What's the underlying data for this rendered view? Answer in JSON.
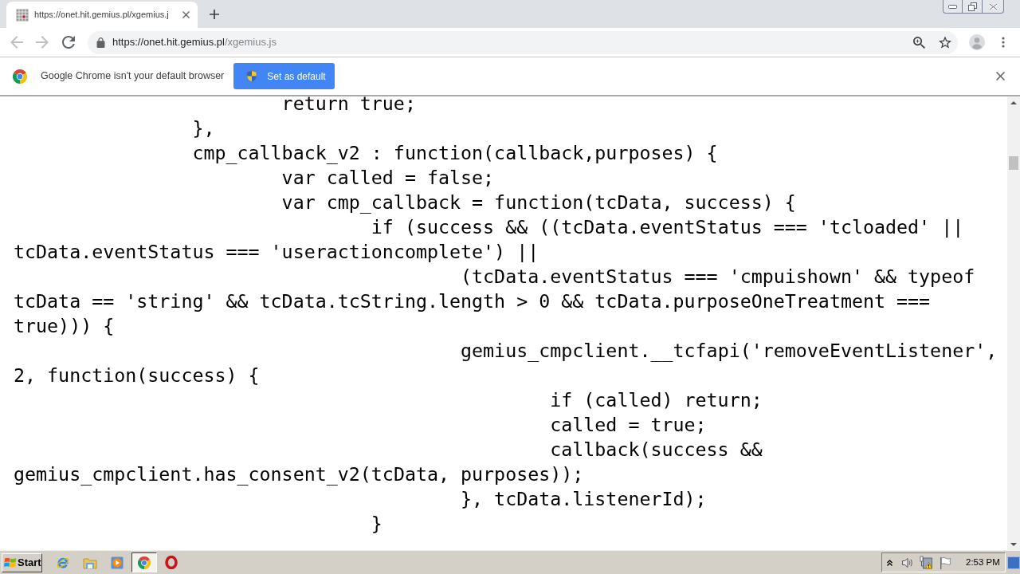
{
  "browser": {
    "tabs": [
      {
        "title": "https://onet.hit.gemius.pl/xgemius.j",
        "selected": true
      }
    ],
    "address_bar": {
      "host": "https://onet.hit.gemius.pl",
      "path": "/xgemius.js"
    }
  },
  "infobar": {
    "message": "Google Chrome isn't your default browser",
    "button": "Set as default"
  },
  "code_lines": [
    "\t\t\treturn true;",
    "\t\t},",
    "\t\tcmp_callback_v2 : function(callback,purposes) {",
    "\t\t\tvar called = false;",
    "\t\t\tvar cmp_callback = function(tcData, success) {",
    "\t\t\t\tif (success && ((tcData.eventStatus === 'tcloaded' ||",
    "tcData.eventStatus === 'useractioncomplete') ||",
    "\t\t\t\t\t(tcData.eventStatus === 'cmpuishown' && typeof",
    "tcData == 'string' && tcData.tcString.length > 0 && tcData.purposeOneTreatment ===",
    "true))) {",
    "\t\t\t\t\tgemius_cmpclient.__tcfapi('removeEventListener',",
    "2, function(success) {",
    "\t\t\t\t\t\tif (called) return;",
    "\t\t\t\t\t\tcalled = true;",
    "\t\t\t\t\t\tcallback(success &&",
    "gemius_cmpclient.has_consent_v2(tcData, purposes));",
    "\t\t\t\t\t}, tcData.listenerId);",
    "\t\t\t\t}"
  ],
  "taskbar": {
    "start": "Start",
    "apps": [
      {
        "kind": "e-logo",
        "selected": false
      },
      {
        "kind": "folder",
        "selected": false
      },
      {
        "kind": "player",
        "selected": false
      },
      {
        "kind": "chrome",
        "selected": true
      },
      {
        "kind": "o-logo",
        "selected": false
      }
    ],
    "clock": "2:53 PM"
  }
}
